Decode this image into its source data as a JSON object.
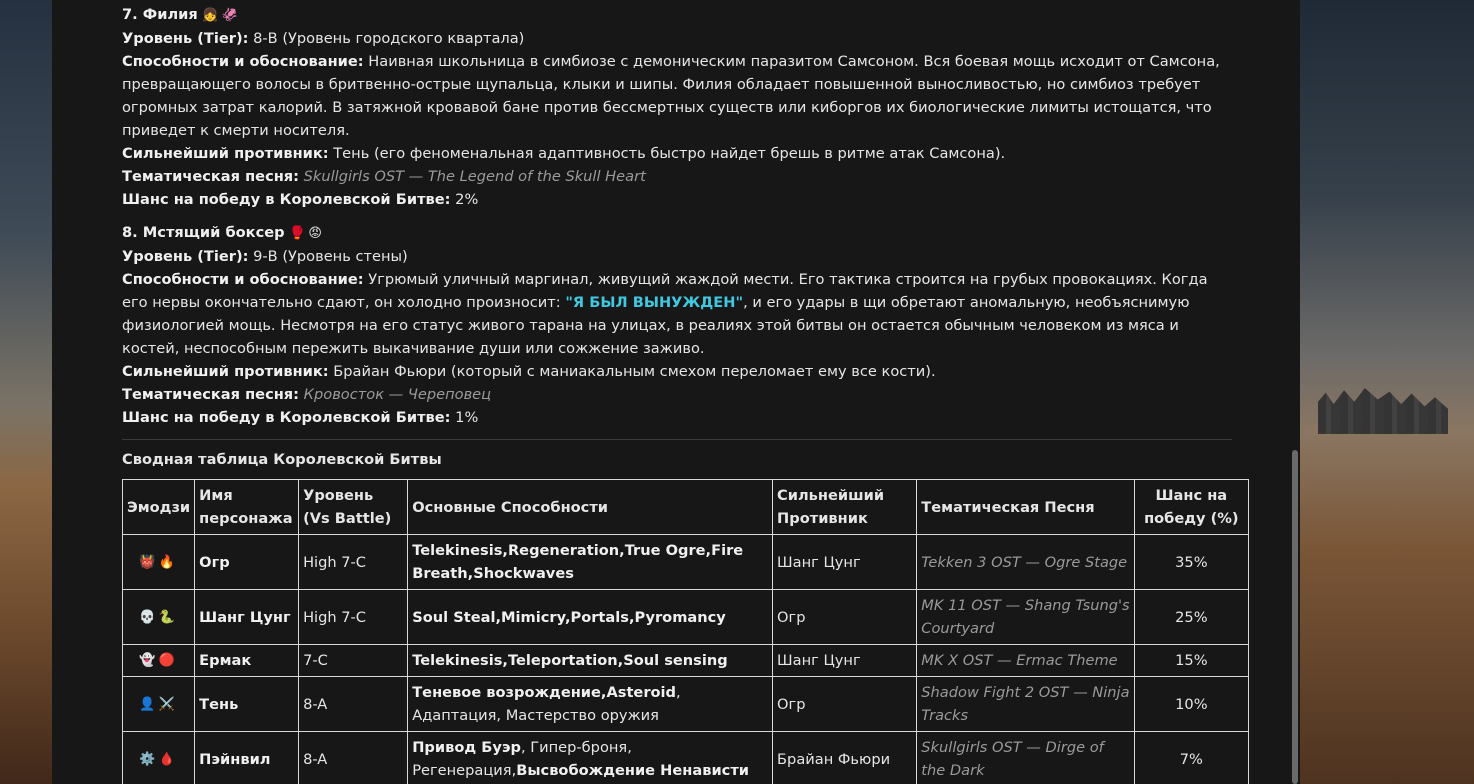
{
  "char7": {
    "heading": "7. Филия",
    "heading_emoji": "👧🦑",
    "tier_label": "Уровень (Tier):",
    "tier_value": "8-B (Уровень городского квартала)",
    "abilities_label": "Способности и обоснование:",
    "abilities_text": "Наивная школьница в симбиозе с демоническим паразитом Самсоном. Вся боевая мощь исходит от Самсона, превращающего волосы в бритвенно-острые щупальца, клыки и шипы. Филия обладает повышенной выносливостью, но симбиоз требует огромных затрат калорий. В затяжной кровавой бане против бессмертных существ или киборгов их биологические лимиты истощатся, что приведет к смерти носителя.",
    "rival_label": "Сильнейший противник:",
    "rival_text": "Тень (его феноменальная адаптивность быстро найдет брешь в ритме атак Самсона).",
    "song_label": "Тематическая песня:",
    "song_text": "Skullgirls OST — The Legend of the Skull Heart",
    "chance_label": "Шанс на победу в Королевской Битве:",
    "chance_value": "2%"
  },
  "char8": {
    "heading": "8. Мстящий боксер",
    "heading_emoji": "🥊😡",
    "tier_label": "Уровень (Tier):",
    "tier_value": "9-B (Уровень стены)",
    "abilities_label": "Способности и обоснование:",
    "abilities_text_1": "Угрюмый уличный маргинал, живущий жаждой мести. Его тактика строится на грубых провокациях. Когда его нервы окончательно сдают, он холодно произносит:",
    "abilities_quote": "\"Я БЫЛ ВЫНУЖДЕН\"",
    "abilities_text_2": ", и его удары в щи обретают аномальную, необъяснимую физиологией мощь. Несмотря на его статус живого тарана на улицах, в реалиях этой битвы он остается обычным человеком из мяса и костей, неспособным пережить выкачивание души или сожжение заживо.",
    "rival_label": "Сильнейший противник:",
    "rival_text": "Брайан Фьюри (который с маниакальным смехом переломает ему все кости).",
    "song_label": "Тематическая песня:",
    "song_text": "Кровосток — Череповец",
    "chance_label": "Шанс на победу в Королевской Битве:",
    "chance_value": "1%"
  },
  "table": {
    "title": "Сводная таблица Королевской Битвы",
    "headers": [
      "Эмодзи",
      "Имя персонажа",
      "Уровень (Vs Battle)",
      "Основные Способности",
      "Сильнейший Противник",
      "Тематическая Песня",
      "Шанс на победу (%)"
    ],
    "rows": [
      {
        "emoji": "👹🔥",
        "name": "Огр",
        "tier": "High 7-C",
        "abilities_bold": "Telekinesis,Regeneration,True Ogre,Fire Breath,Shockwaves",
        "abilities_plain": "",
        "rival": "Шанг Цунг",
        "song": "Tekken 3 OST — Ogre Stage",
        "chance": "35%"
      },
      {
        "emoji": "💀🐍",
        "name": "Шанг Цунг",
        "tier": "High 7-C",
        "abilities_bold": "Soul Steal,Mimicry,Portals,Pyromancy",
        "abilities_plain": "",
        "rival": "Огр",
        "song": "MK 11 OST — Shang Tsung's Courtyard",
        "chance": "25%"
      },
      {
        "emoji": "👻🔴",
        "name": "Ермак",
        "tier": "7-C",
        "abilities_bold": "Telekinesis,Teleportation,Soul sensing",
        "abilities_plain": "",
        "rival": "Шанг Цунг",
        "song": "MK X OST — Ermac Theme",
        "chance": "15%"
      },
      {
        "emoji": "👤⚔️",
        "name": "Тень",
        "tier": "8-A",
        "abilities_bold": "Теневое возрождение,Asteroid",
        "abilities_plain": ", Адаптация, Мастерство оружия",
        "rival": "Огр",
        "song": "Shadow Fight 2 OST — Ninja Tracks",
        "chance": "10%"
      },
      {
        "emoji": "⚙️🩸",
        "name": "Пэйнвил",
        "tier": "8-A",
        "abilities_bold": "Привод Буэр",
        "abilities_plain": ", Гипер-броня, Регенерация,",
        "abilities_bold2": "Высвобождение Ненависти",
        "rival": "Брайан Фьюри",
        "song": "Skullgirls OST — Dirge of the Dark",
        "chance": "7%"
      }
    ]
  }
}
